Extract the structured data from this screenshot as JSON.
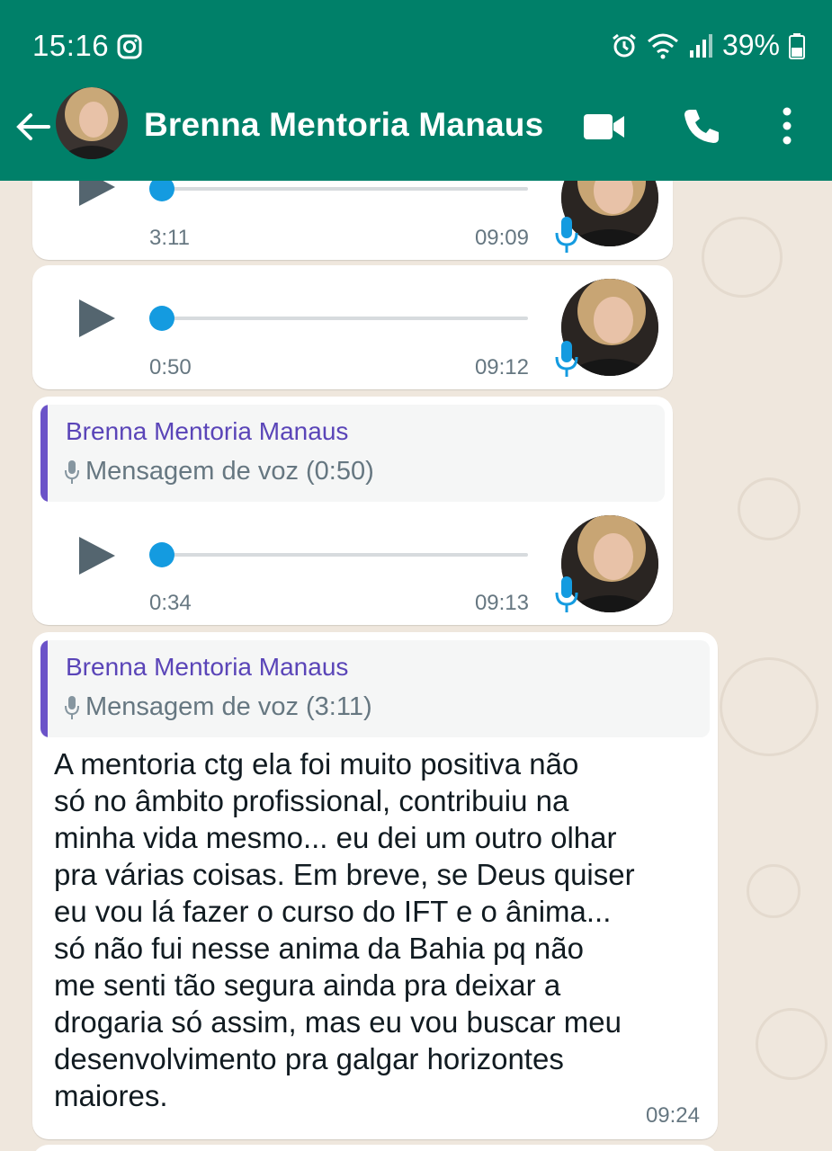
{
  "status_bar": {
    "time": "15:16",
    "battery": "39%"
  },
  "header": {
    "contact_name": "Brenna Mentoria Manaus"
  },
  "messages": [
    {
      "duration": "3:11",
      "time": "09:09"
    },
    {
      "duration": "0:50",
      "time": "09:12"
    },
    {
      "quote_name": "Brenna Mentoria Manaus",
      "quote_text": "Mensagem de voz (0:50)",
      "duration": "0:34",
      "time": "09:13"
    },
    {
      "quote_name": "Brenna Mentoria Manaus",
      "quote_text": "Mensagem de voz (3:11)",
      "lines": [
        "A mentoria ctg ela foi muito positiva não",
        "só no âmbito profissional, contribuiu na",
        "minha vida mesmo... eu dei um outro olhar",
        "pra várias coisas. Em breve, se Deus quiser",
        "eu vou lá fazer o curso do IFT e o ânima...",
        "só não fui nesse anima da Bahia pq não",
        "me senti tão segura ainda pra deixar a",
        "drogaria só assim, mas eu vou buscar meu",
        "desenvolvimento pra galgar horizontes",
        "maiores."
      ],
      "time": "09:24"
    }
  ],
  "colors": {
    "header": "#008069",
    "chat_bg": "#efe7dd",
    "accent_blue": "#149be0",
    "quote_name": "#5a45b8"
  }
}
